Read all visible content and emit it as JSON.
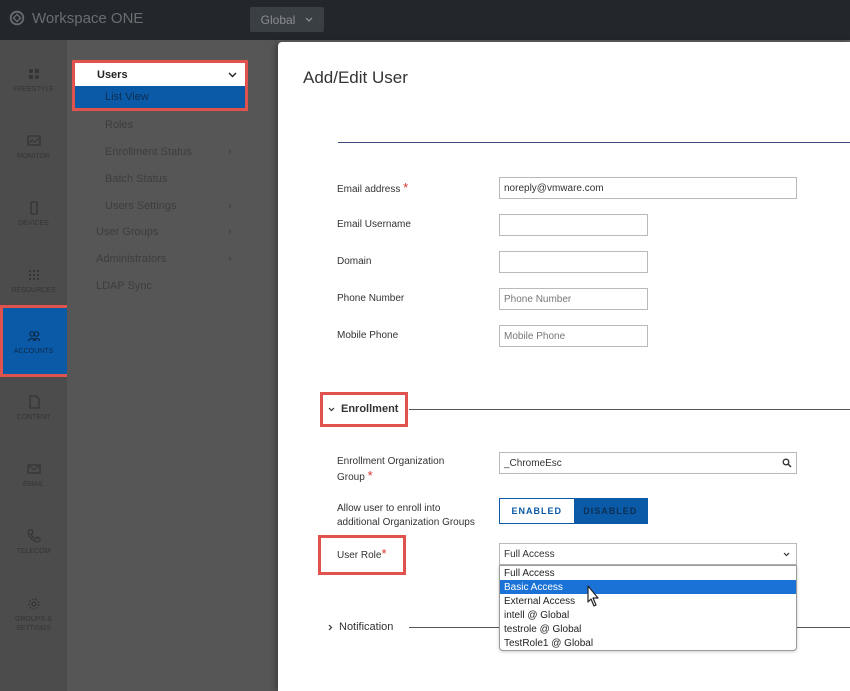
{
  "topbar": {
    "brand": "Workspace ONE",
    "org_button": "Global"
  },
  "rail": [
    {
      "label": "FREESTYLE",
      "icon": "freestyle-icon"
    },
    {
      "label": "MONITOR",
      "icon": "monitor-icon"
    },
    {
      "label": "DEVICES",
      "icon": "device-icon"
    },
    {
      "label": "RESOURCES",
      "icon": "resources-icon"
    },
    {
      "label": "ACCOUNTS",
      "icon": "accounts-icon"
    },
    {
      "label": "CONTENT",
      "icon": "content-icon"
    },
    {
      "label": "EMAIL",
      "icon": "email-icon"
    },
    {
      "label": "TELECOM",
      "icon": "telecom-icon"
    },
    {
      "label": "GROUPS & SETTINGS",
      "icon": "settings-icon"
    }
  ],
  "subnav": {
    "users": "Users",
    "list_view": "List View",
    "roles": "Roles",
    "enrollment_status": "Enrollment Status",
    "batch_status": "Batch Status",
    "users_settings": "Users Settings",
    "user_groups": "User Groups",
    "administrators": "Administrators",
    "ldap_sync": "LDAP Sync"
  },
  "modal": {
    "title": "Add/Edit User",
    "fields": {
      "email_label": "Email address",
      "email_value": "noreply@vmware.com",
      "username_label": "Email Username",
      "domain_label": "Domain",
      "phone_label": "Phone Number",
      "phone_placeholder": "Phone Number",
      "mobile_label": "Mobile Phone",
      "mobile_placeholder": "Mobile Phone"
    },
    "enrollment": {
      "section": "Enrollment",
      "org_group_label_1": "Enrollment Organization",
      "org_group_label_2": "Group",
      "org_group_value": "_ChromeEsc",
      "allow_label_1": "Allow user to enroll into",
      "allow_label_2": "additional Organization Groups",
      "toggle_enabled": "ENABLED",
      "toggle_disabled": "DISABLED",
      "role_label": "User Role",
      "role_value": "Full Access",
      "role_options": [
        "Full Access",
        "Basic Access",
        "External Access",
        "intell @ Global",
        "testrole @ Global",
        "TestRole1 @ Global"
      ]
    },
    "notification": {
      "section": "Notification"
    }
  },
  "colors": {
    "accent": "#0b5aa8",
    "highlight": "#e0524e",
    "required": "#d9342b",
    "option_selected": "#1a72d6"
  }
}
